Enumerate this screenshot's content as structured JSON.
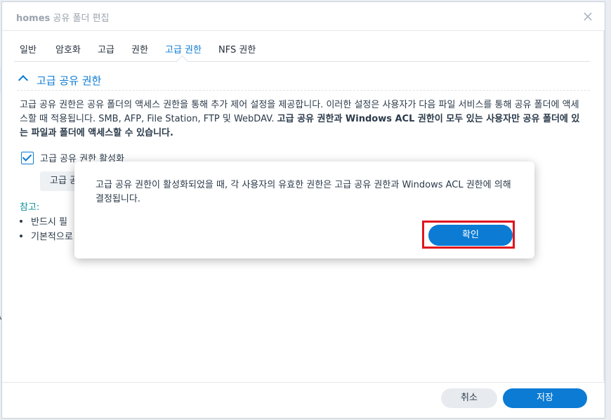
{
  "window": {
    "title_bold": "homes",
    "title_rest": " 공유 폴더 편집",
    "close_icon": "close-icon"
  },
  "tabs": [
    {
      "label": "일반"
    },
    {
      "label": "암호화"
    },
    {
      "label": "고급"
    },
    {
      "label": "권한"
    },
    {
      "label": "고급 권한",
      "active": true
    },
    {
      "label": "NFS 권한"
    }
  ],
  "section": {
    "title": "고급 공유 권한",
    "icon": "chevron-up-icon"
  },
  "description": {
    "plain": "고급 공유 권한은 공유 폴더의 액세스 권한을 통해 추가 제어 설정을 제공합니다. 이러한 설정은 사용자가 다음 파일 서비스를 통해 공유 폴더에 액세스할 때 적용됩니다. SMB, AFP, File Station, FTP 및 WebDAV. ",
    "bold": "고급 공유 권한과 Windows ACL 권한이 모두 있는 사용자만 공유 폴더에 있는 파일과 폴더에 액세스할 수 있습니다."
  },
  "checkbox": {
    "label": "고급 공유 권한 활성화",
    "checked": true
  },
  "advanced_button": {
    "label": "고급 공유 권한"
  },
  "notes": {
    "title": "참고:",
    "items": [
      "반드시 필",
      "기본적으로"
    ]
  },
  "background": {
    "edge_text": "v"
  },
  "footer": {
    "cancel_label": "취소",
    "save_label": "저장"
  },
  "modal": {
    "message": "고급 공유 권한이 활성화되었을 때, 각 사용자의 유효한 권한은 고급 공유 권한과 Windows ACL 권한에 의해 결정됩니다.",
    "ok_label": "확인"
  },
  "colors": {
    "accent": "#0b7bd4",
    "highlight": "#e0141e",
    "note": "#0b8f9a"
  }
}
